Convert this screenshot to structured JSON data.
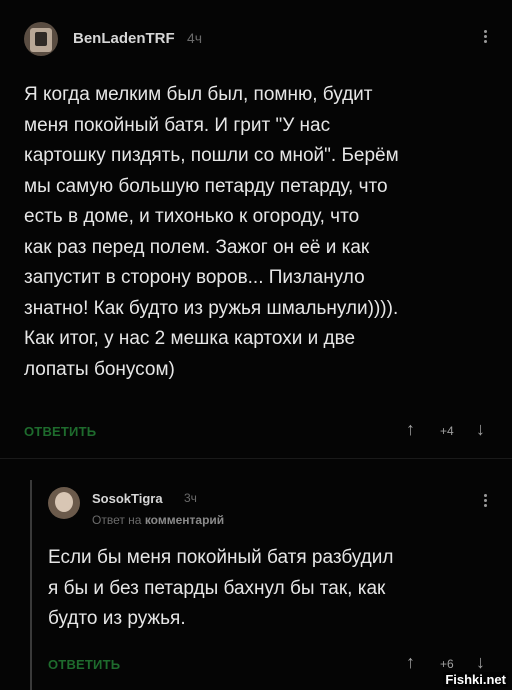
{
  "comments": [
    {
      "username": "BenLadenTRF",
      "time": "4ч",
      "text": "Я когда мелким был был, помню, будит\nменя покойный батя. И грит \"У нас\nкартошку пиздять, пошли со мной\". Берём\nмы самую большую петарду петарду, что\nесть в доме, и тихонько к огороду, что\nкак раз перед полем. Зажог он её и как\nзапустит в сторону воров... Пизлануло\nзнатно! Как будто из ружья шмальнули)))).\nКак итог, у нас 2 мешка картохи и две\nлопаты бонусом)",
      "reply_label": "ОТВЕТИТЬ",
      "score": "+4",
      "upvote_icon": "arrow-up-icon",
      "downvote_icon": "arrow-down-icon"
    },
    {
      "username": "SosokTigra",
      "time": "3ч",
      "reply_prefix": "Ответ на",
      "reply_target": "комментарий",
      "text": "Если бы меня покойный батя разбудил\nя бы и без петарды бахнул бы так, как\nбудто из ружья.",
      "reply_label": "ОТВЕТИТЬ",
      "score": "+6",
      "upvote_icon": "arrow-up-icon",
      "downvote_icon": "arrow-down-icon"
    }
  ],
  "watermark": "Fishki.net",
  "colors": {
    "background": "#050505",
    "reply_link": "#1e6b2d",
    "text": "#e6e6e6"
  }
}
